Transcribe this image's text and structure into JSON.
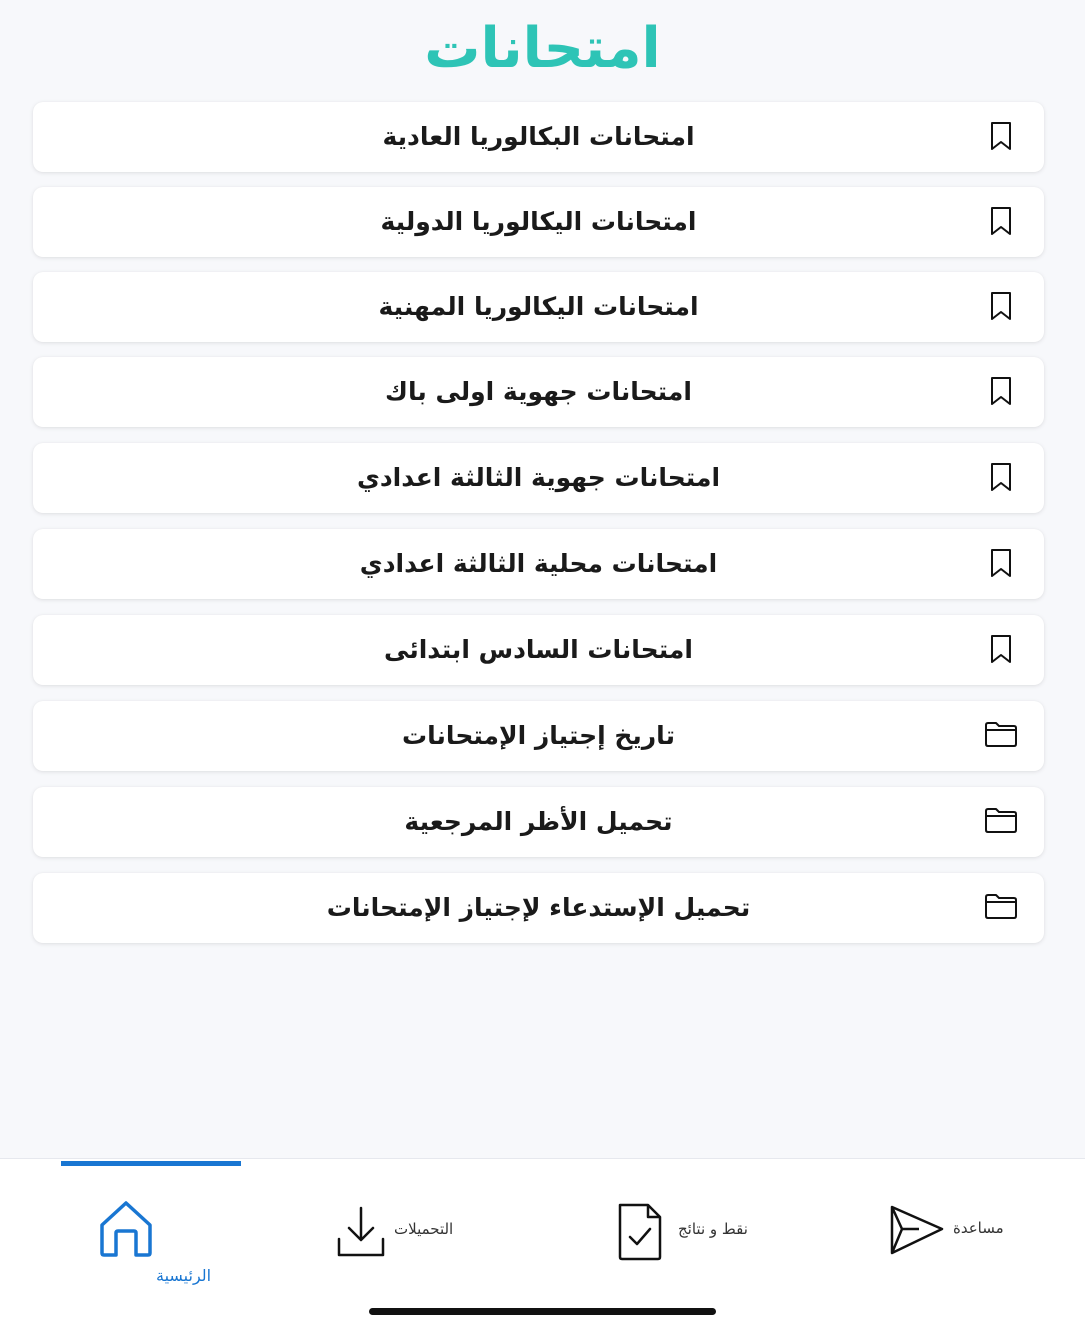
{
  "header": {
    "title": "امتحانات"
  },
  "menu": {
    "items": [
      {
        "label": "امتحانات البكالوريا العادية",
        "icon": "bookmark-icon"
      },
      {
        "label": "امتحانات اليكالوريا الدولية",
        "icon": "bookmark-icon"
      },
      {
        "label": "امتحانات اليكالوريا المهنية",
        "icon": "bookmark-icon"
      },
      {
        "label": "امتحانات جهوية اولى باك",
        "icon": "bookmark-icon"
      },
      {
        "label": "امتحانات جهوية الثالثة اعدادي",
        "icon": "bookmark-icon"
      },
      {
        "label": "امتحانات محلية الثالثة اعدادي",
        "icon": "bookmark-icon"
      },
      {
        "label": "امتحانات السادس ابتدائى",
        "icon": "bookmark-icon"
      },
      {
        "label": "تاريخ إجتياز الإمتحانات",
        "icon": "folder-icon"
      },
      {
        "label": "تحميل الأظر المرجعية",
        "icon": "folder-icon"
      },
      {
        "label": "تحميل الإستدعاء لإجتياز الإمتحانات",
        "icon": "folder-icon"
      }
    ]
  },
  "tabbar": {
    "home": {
      "label": "الرئيسية",
      "icon": "home-icon",
      "active": true
    },
    "downloads": {
      "label": "التحميلات",
      "icon": "download-icon"
    },
    "results": {
      "label": "نقط و نتائج",
      "icon": "document-check-icon"
    },
    "help": {
      "label": "مساعدة",
      "icon": "send-icon"
    }
  },
  "colors": {
    "title": "#2ec4b6",
    "accent": "#1976d2",
    "text": "#1a1a1a",
    "background": "#f7f8fb"
  }
}
